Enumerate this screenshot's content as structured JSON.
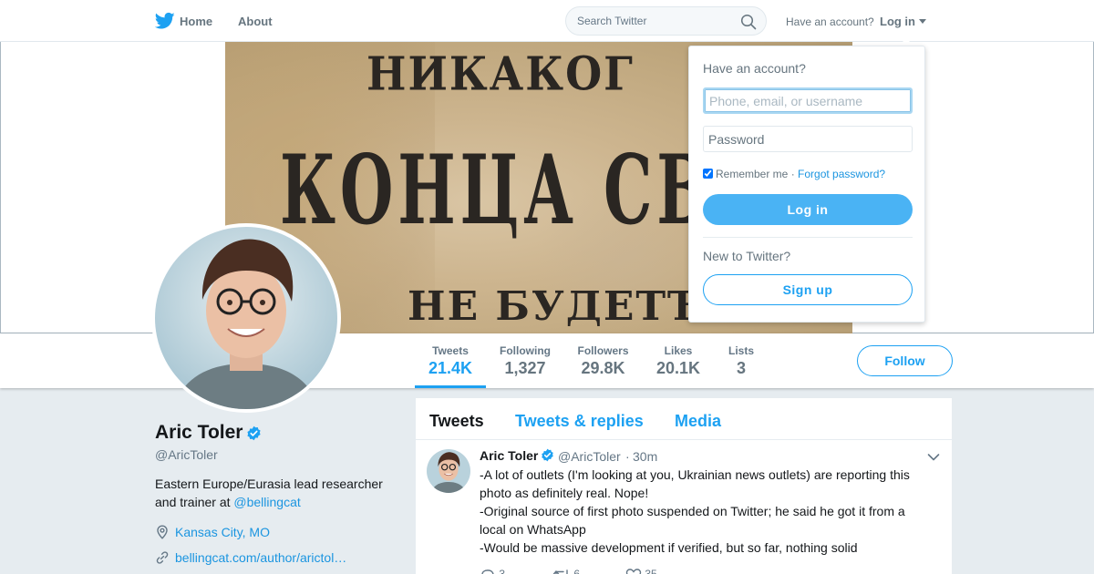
{
  "nav": {
    "logo_icon": "twitter-bird-icon",
    "home": "Home",
    "about": "About",
    "search_placeholder": "Search Twitter",
    "have_account": "Have an account?",
    "login": "Log in"
  },
  "banner": {
    "line1": "НИКАКОГ",
    "line2": "КОНЦА СВѢ",
    "line3": "НЕ БУДЕТЪ"
  },
  "stats": [
    {
      "label": "Tweets",
      "value": "21.4K",
      "active": true
    },
    {
      "label": "Following",
      "value": "1,327"
    },
    {
      "label": "Followers",
      "value": "29.8K"
    },
    {
      "label": "Likes",
      "value": "20.1K"
    },
    {
      "label": "Lists",
      "value": "3"
    }
  ],
  "follow_button": "Follow",
  "profile": {
    "name": "Aric Toler",
    "handle": "@AricToler",
    "bio": "Eastern Europe/Eurasia lead researcher and trainer at ",
    "bio_mention": "@bellingcat",
    "location": "Kansas City, MO",
    "url": "bellingcat.com/author/arictol…"
  },
  "timeline": {
    "tabs": [
      "Tweets",
      "Tweets & replies",
      "Media"
    ],
    "tweet": {
      "name": "Aric Toler",
      "handle": "@AricToler",
      "dot": "·",
      "time": "30m",
      "lines": [
        "-A lot of outlets (I'm looking at you, Ukrainian news outlets) are reporting this",
        "photo as definitely real. Nope!",
        "-Original source of first photo suspended on Twitter; he said he got it from a",
        "local on WhatsApp",
        "-Would be massive development if verified, but so far, nothing solid"
      ],
      "replies": "3",
      "retweets": "6",
      "likes": "35"
    }
  },
  "login_dropdown": {
    "title": "Have an account?",
    "username_placeholder": "Phone, email, or username",
    "password_placeholder": "Password",
    "remember": "Remember me",
    "separator": " · ",
    "forgot": "Forgot password?",
    "login_button": "Log in",
    "new_to": "New to Twitter?",
    "signup_button": "Sign up"
  },
  "colors": {
    "brand_blue": "#1da1f2",
    "link_blue": "#1b95e0",
    "muted_gray": "#657786",
    "page_bg": "#e6ecf0"
  }
}
